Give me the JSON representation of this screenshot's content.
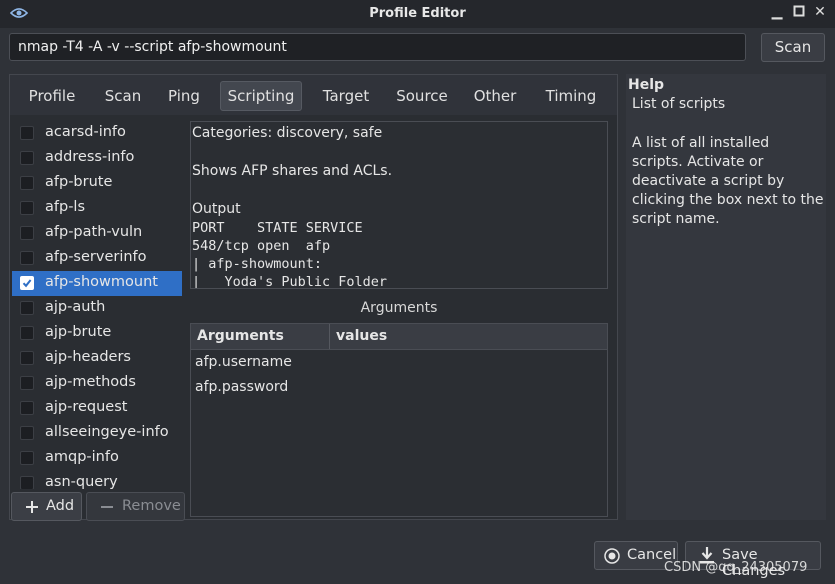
{
  "window": {
    "title": "Profile Editor"
  },
  "command": {
    "value": "nmap -T4 -A -v --script afp-showmount"
  },
  "scan_label": "Scan",
  "tabs": [
    {
      "label": "Profile"
    },
    {
      "label": "Scan"
    },
    {
      "label": "Ping"
    },
    {
      "label": "Scripting"
    },
    {
      "label": "Target"
    },
    {
      "label": "Source"
    },
    {
      "label": "Other"
    },
    {
      "label": "Timing"
    }
  ],
  "active_tab": "Scripting",
  "scripts": [
    {
      "name": "acarsd-info",
      "checked": false
    },
    {
      "name": "address-info",
      "checked": false
    },
    {
      "name": "afp-brute",
      "checked": false
    },
    {
      "name": "afp-ls",
      "checked": false
    },
    {
      "name": "afp-path-vuln",
      "checked": false
    },
    {
      "name": "afp-serverinfo",
      "checked": false
    },
    {
      "name": "afp-showmount",
      "checked": true
    },
    {
      "name": "ajp-auth",
      "checked": false
    },
    {
      "name": "ajp-brute",
      "checked": false
    },
    {
      "name": "ajp-headers",
      "checked": false
    },
    {
      "name": "ajp-methods",
      "checked": false
    },
    {
      "name": "ajp-request",
      "checked": false
    },
    {
      "name": "allseeingeye-info",
      "checked": false
    },
    {
      "name": "amqp-info",
      "checked": false
    },
    {
      "name": "asn-query",
      "checked": false
    }
  ],
  "description": {
    "categories": "Categories: discovery, safe",
    "summary": "Shows AFP shares and ACLs.",
    "output_label": "Output",
    "output_lines": [
      "PORT    STATE SERVICE",
      "548/tcp open  afp",
      "| afp-showmount:",
      "|   Yoda's Public Folder"
    ]
  },
  "arguments": {
    "title": "Arguments",
    "col_arguments": "Arguments",
    "col_values": "values",
    "rows": [
      "afp.username",
      "afp.password"
    ]
  },
  "buttons": {
    "add": "Add",
    "remove": "Remove",
    "cancel": "Cancel",
    "save": "Save Changes"
  },
  "help": {
    "title": "Help",
    "subtitle": "List of scripts",
    "body": "A list of all installed scripts. Activate or deactivate a script by clicking the box next to the script name."
  },
  "watermark": "CSDN @qq_24305079",
  "colors": {
    "background": "#2f3238",
    "selection": "#2f6fc6"
  }
}
